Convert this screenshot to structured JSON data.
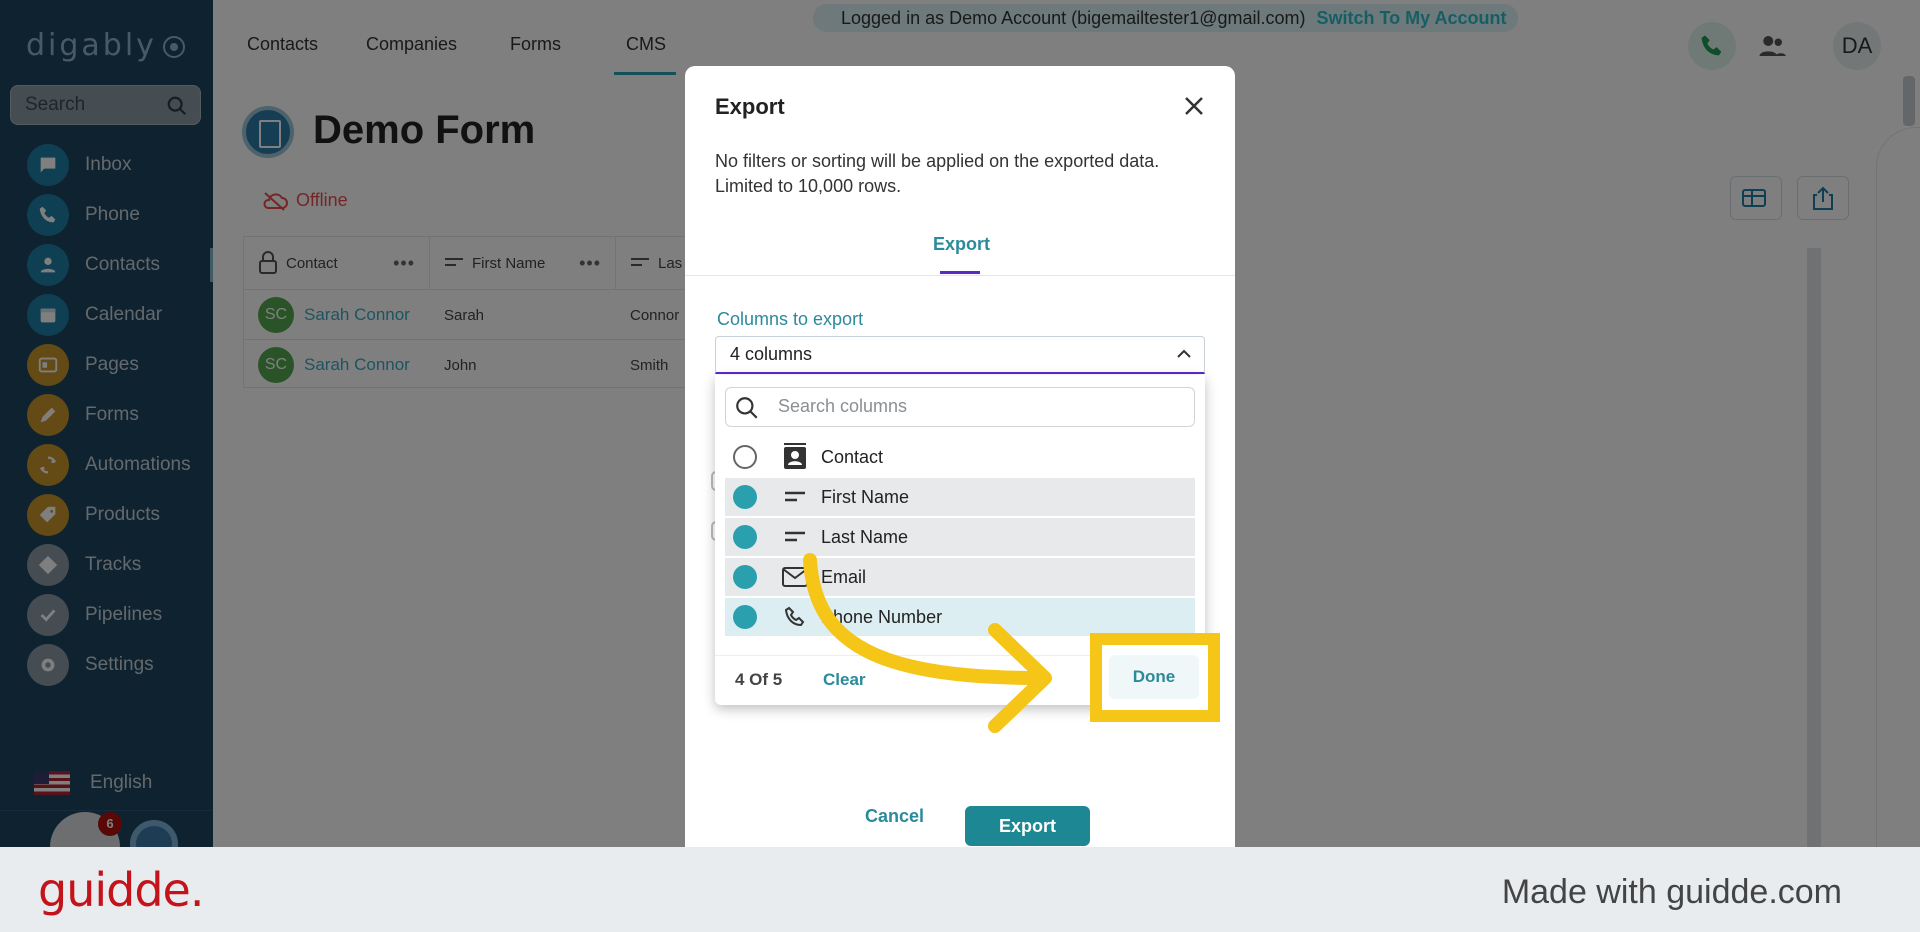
{
  "sidebar": {
    "logo": "digably",
    "search_placeholder": "Search",
    "items": [
      {
        "label": "Inbox",
        "icon": "inbox-icon",
        "color": "#1f7ea6"
      },
      {
        "label": "Phone",
        "icon": "phone-icon",
        "color": "#1f7ea6"
      },
      {
        "label": "Contacts",
        "icon": "contacts-icon",
        "color": "#1f7ea6"
      },
      {
        "label": "Calendar",
        "icon": "calendar-icon",
        "color": "#1f7ea6"
      },
      {
        "label": "Pages",
        "icon": "pages-icon",
        "color": "#c8952a"
      },
      {
        "label": "Forms",
        "icon": "forms-icon",
        "color": "#c8952a"
      },
      {
        "label": "Automations",
        "icon": "automations-icon",
        "color": "#c8952a"
      },
      {
        "label": "Products",
        "icon": "products-icon",
        "color": "#c8952a"
      },
      {
        "label": "Tracks",
        "icon": "tracks-icon",
        "color": "#8a9aa5"
      },
      {
        "label": "Pipelines",
        "icon": "pipelines-icon",
        "color": "#8a9aa5"
      },
      {
        "label": "Settings",
        "icon": "settings-icon",
        "color": "#8a9aa5"
      }
    ],
    "language": "English",
    "notification_count": "6"
  },
  "topbar": {
    "tabs": [
      "Contacts",
      "Companies",
      "Forms",
      "CMS"
    ],
    "login_text": "Logged in as Demo Account (bigemailtester1@gmail.com)",
    "switch_link": "Switch To My Account",
    "avatar_initials": "DA"
  },
  "page": {
    "title": "Demo Form",
    "status": "Offline",
    "table": {
      "headers": [
        "Contact",
        "First Name",
        "Las"
      ],
      "rows": [
        {
          "initials": "SC",
          "contact": "Sarah Connor",
          "first": "Sarah",
          "last": "Connor"
        },
        {
          "initials": "SC",
          "contact": "Sarah Connor",
          "first": "John",
          "last": "Smith"
        }
      ]
    }
  },
  "modal": {
    "title": "Export",
    "description": "No filters or sorting will be applied on the exported data. Limited to 10,000 rows.",
    "tab": "Export",
    "columns_label": "Columns to export",
    "select_value": "4 columns",
    "cancel_label": "Cancel",
    "export_label": "Export"
  },
  "dropdown": {
    "search_placeholder": "Search columns",
    "options": [
      {
        "label": "Contact",
        "selected": false,
        "icon": "contact-card-icon"
      },
      {
        "label": "First Name",
        "selected": true,
        "icon": "text-lines-icon"
      },
      {
        "label": "Last Name",
        "selected": true,
        "icon": "text-lines-icon"
      },
      {
        "label": "Email",
        "selected": true,
        "icon": "mail-icon"
      },
      {
        "label": "Phone Number",
        "selected": true,
        "icon": "phone-icon"
      }
    ],
    "count_text": "4 Of 5",
    "clear_label": "Clear",
    "done_label": "Done"
  },
  "footer": {
    "brand": "guidde.",
    "made_with": "Made with guidde.com"
  },
  "colors": {
    "accent": "#2b8a9b",
    "highlight": "#f5c518",
    "brand_red": "#c4141b"
  }
}
